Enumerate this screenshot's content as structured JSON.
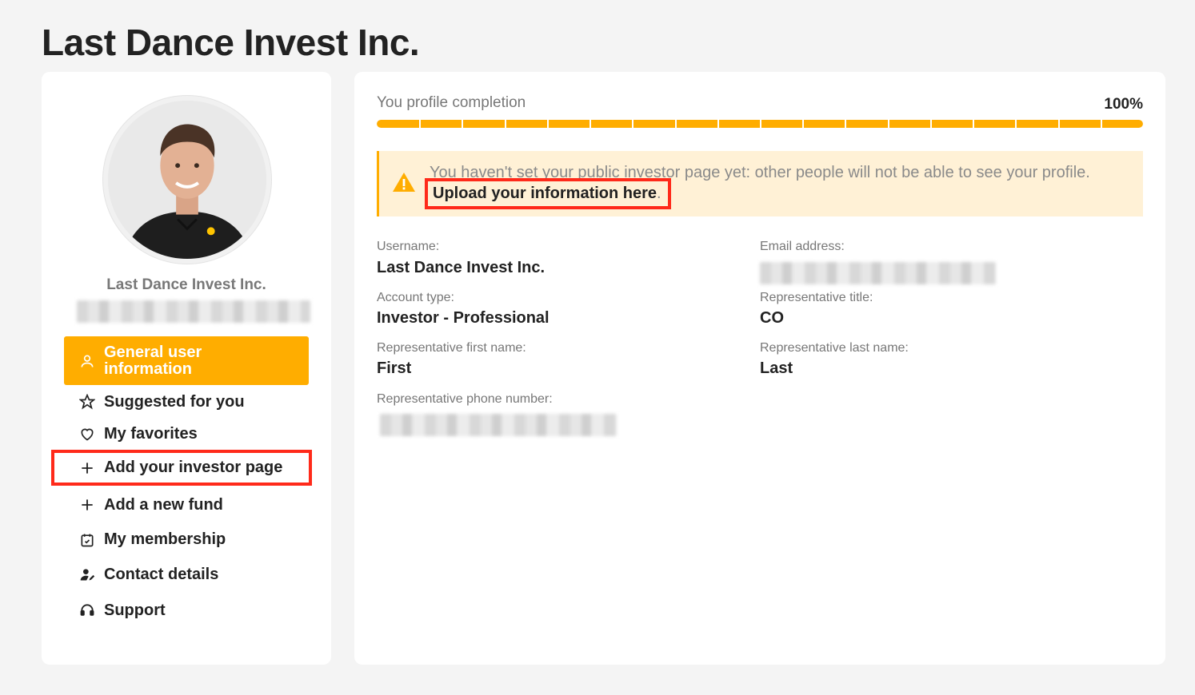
{
  "page": {
    "title": "Last Dance Invest Inc."
  },
  "sidebar": {
    "profile_name": "Last Dance Invest Inc.",
    "nav": [
      {
        "label": "General user information",
        "icon": "user-icon"
      },
      {
        "label": "Suggested for you",
        "icon": "star-icon"
      },
      {
        "label": "My favorites",
        "icon": "heart-icon"
      },
      {
        "label": "Add your investor page",
        "icon": "plus-icon"
      },
      {
        "label": "Add a new fund",
        "icon": "plus-icon"
      },
      {
        "label": "My membership",
        "icon": "calendar-check-icon"
      },
      {
        "label": "Contact details",
        "icon": "user-edit-icon"
      },
      {
        "label": "Support",
        "icon": "headset-icon"
      }
    ]
  },
  "profile_completion": {
    "label": "You profile completion",
    "value_text": "100%",
    "value": 1.0
  },
  "alert": {
    "icon": "warning-icon",
    "text": "You haven't set your public investor page yet: other people will not be able to see your profile.",
    "link_text": "Upload your information here",
    "link_suffix": "."
  },
  "fields": {
    "username_label": "Username:",
    "username": "Last Dance Invest Inc.",
    "email_label": "Email address:",
    "account_type_label": "Account type:",
    "account_type": "Investor - Professional",
    "rep_title_label": "Representative title:",
    "rep_title": "CO",
    "rep_first_label": "Representative first name:",
    "rep_first": "First",
    "rep_last_label": "Representative last name:",
    "rep_last": "Last",
    "rep_phone_label": "Representative phone number:"
  },
  "colors": {
    "accent": "#ffad00",
    "highlight_border": "#ff2a1a",
    "alert_bg": "#fff1d6"
  }
}
